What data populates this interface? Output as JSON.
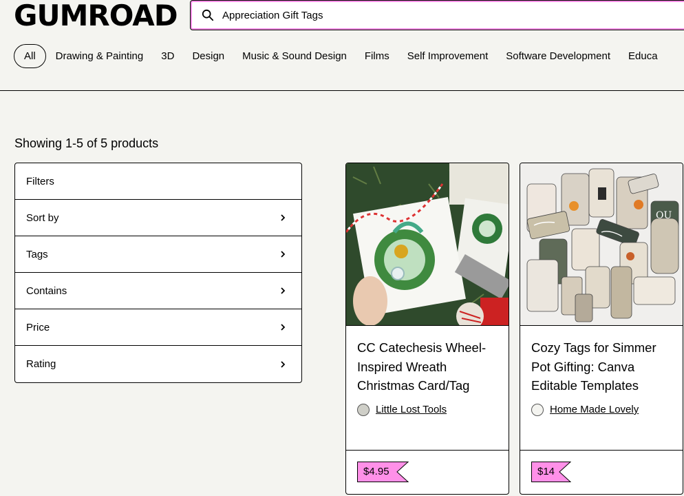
{
  "header": {
    "logo": "Gumroad",
    "search_value": "Appreciation Gift Tags",
    "search_icon": "search-icon"
  },
  "categories": [
    {
      "label": "All",
      "active": true
    },
    {
      "label": "Drawing & Painting"
    },
    {
      "label": "3D"
    },
    {
      "label": "Design"
    },
    {
      "label": "Music & Sound Design"
    },
    {
      "label": "Films"
    },
    {
      "label": "Self Improvement"
    },
    {
      "label": "Software Development"
    },
    {
      "label": "Educa"
    }
  ],
  "results": {
    "showing": "Showing 1-5 of 5 products"
  },
  "filters": {
    "items": [
      {
        "label": "Filters"
      },
      {
        "label": "Sort by",
        "icon": "chevron-right-icon"
      },
      {
        "label": "Tags",
        "icon": "chevron-right-icon"
      },
      {
        "label": "Contains",
        "icon": "chevron-right-icon"
      },
      {
        "label": "Price",
        "icon": "chevron-right-icon"
      },
      {
        "label": "Rating",
        "icon": "chevron-right-icon"
      }
    ]
  },
  "products": [
    {
      "title": "CC Catechesis Wheel-Inspired Wreath Christmas Card/Tag",
      "creator": "Little Lost Tools",
      "price": "$4.95"
    },
    {
      "title": "Cozy Tags for Simmer Pot Gifting: Canva Editable Templates",
      "creator": "Home Made Lovely",
      "price": "$14"
    }
  ],
  "colors": {
    "background": "#f4f4f0",
    "price_tag": "#ff90e8",
    "accent": "#ff90e8"
  }
}
